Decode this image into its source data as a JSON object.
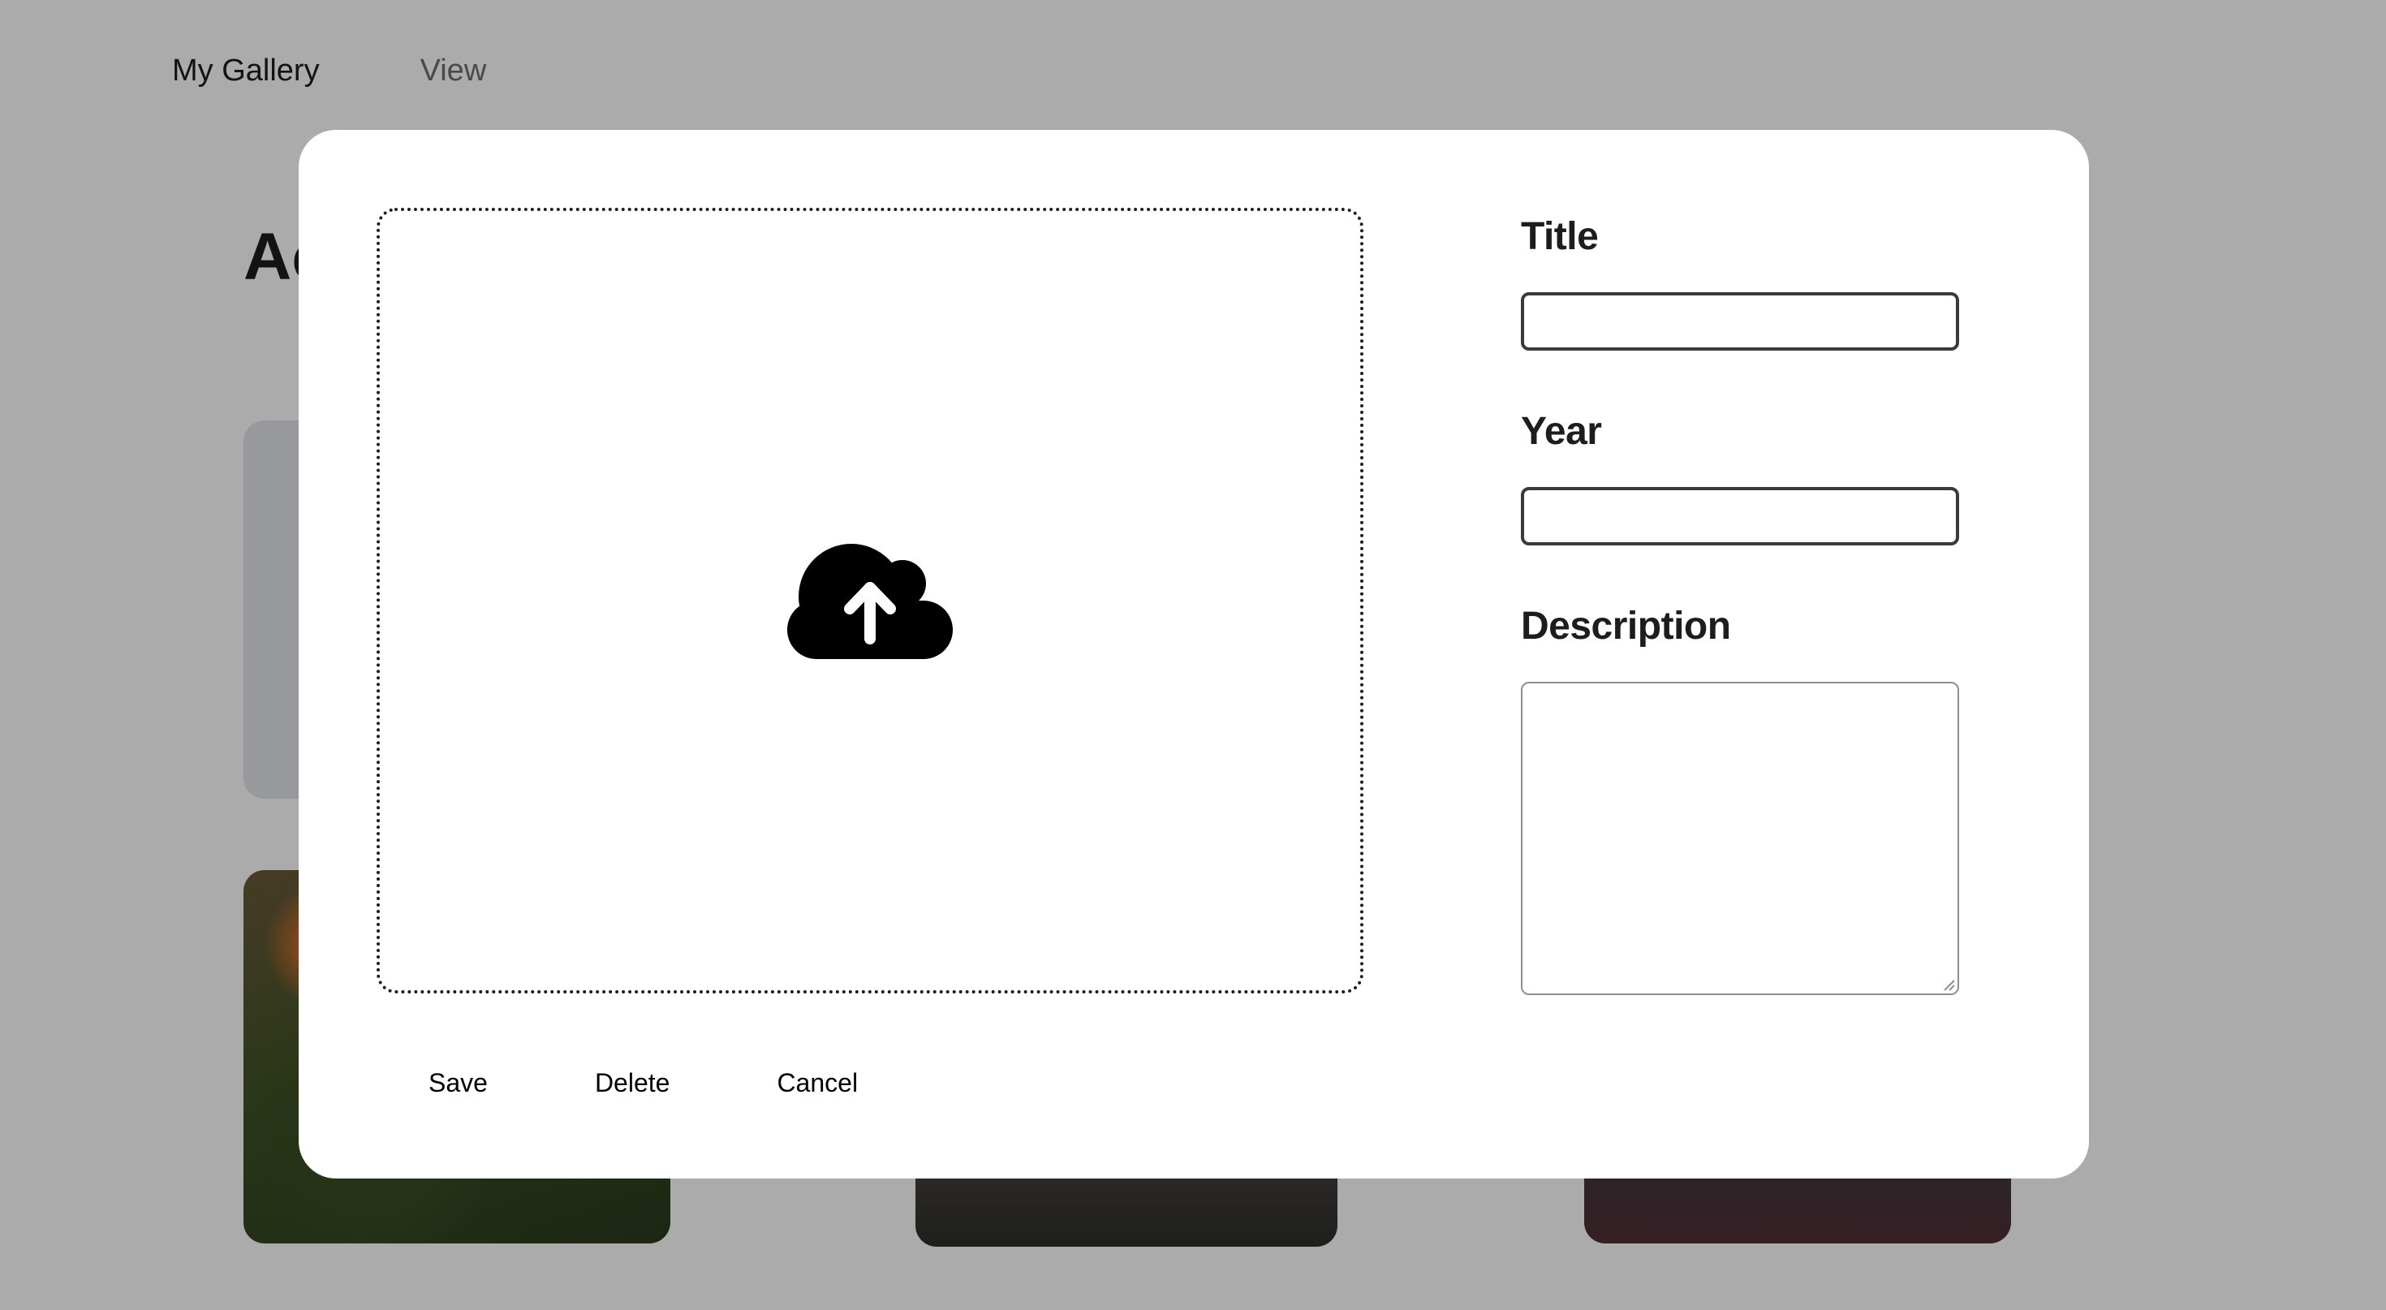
{
  "nav": {
    "brand": "My Gallery",
    "view_link": "View"
  },
  "page": {
    "heading_visible_fragment": "Ac"
  },
  "modal": {
    "upload_icon": "cloud-upload-icon",
    "fields": {
      "title_label": "Title",
      "title_value": "",
      "year_label": "Year",
      "year_value": "",
      "description_label": "Description",
      "description_value": ""
    },
    "actions": {
      "save_label": "Save",
      "delete_label": "Delete",
      "cancel_label": "Cancel"
    }
  },
  "colors": {
    "overlay": "#000000",
    "modal_background": "#ffffff",
    "add_card": "#e2e4e9",
    "text": "#1d1d1f"
  }
}
